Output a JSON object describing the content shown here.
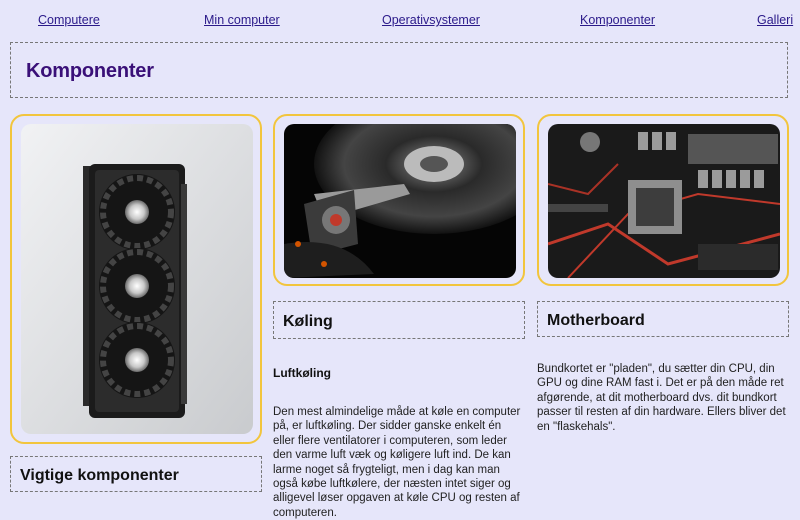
{
  "nav": {
    "items": [
      "Computere",
      "Min computer",
      "Operativsystemer",
      "Komponenter",
      "Galleri"
    ]
  },
  "header": {
    "title": "Komponenter"
  },
  "cards": {
    "gpu": {
      "icon": "graphics-card-photo"
    },
    "disk": {
      "icon": "hard-drive-photo"
    },
    "board": {
      "icon": "motherboard-photo"
    }
  },
  "sections": {
    "vigtige": {
      "title": "Vigtige komponenter"
    },
    "koeling": {
      "title": "Køling",
      "subtitle": "Luftkøling",
      "text": "Den mest almindelige måde at køle en computer på, er luftkøling. Der sidder ganske enkelt én eller flere ventilatorer i computeren, som leder den varme luft væk og køligere luft ind. De kan larme noget så frygteligt, men i dag kan man også købe luftkølere, der næsten intet siger og alligevel løser opgaven at køle CPU og resten af computeren."
    },
    "motherboard": {
      "title": "Motherboard",
      "text": "Bundkortet er \"pladen\", du sætter din CPU, din GPU og dine RAM fast i. Det er på den måde ret afgørende, at dit motherboard dvs. dit bundkort passer til resten af din hardware. Ellers bliver det en \"flaskehals\"."
    }
  },
  "colors": {
    "background": "#e6e6fa",
    "accent": "#f2c53d",
    "title": "#3a1078",
    "link": "#2b1a8a"
  }
}
